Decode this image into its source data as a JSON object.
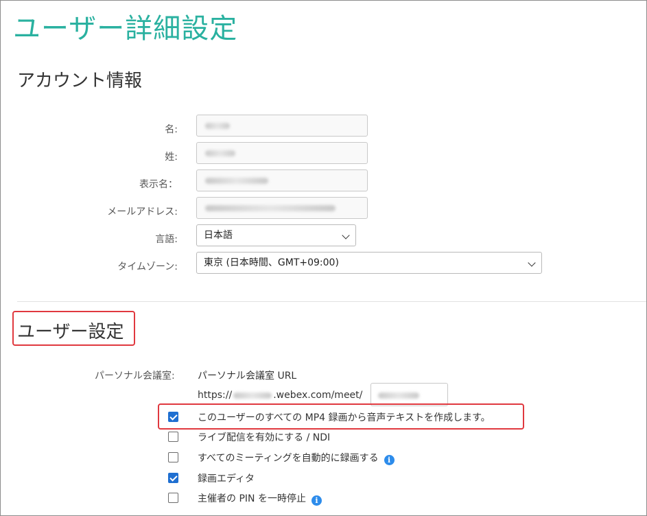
{
  "page_title": "ユーザー詳細設定",
  "account": {
    "section_title": "アカウント情報",
    "fields": [
      {
        "label": "名:",
        "value": ""
      },
      {
        "label": "姓:",
        "value": ""
      },
      {
        "label": "表示名：",
        "value": ""
      },
      {
        "label": "メールアドレス:",
        "value": ""
      }
    ],
    "language": {
      "label": "言語:",
      "selected": "日本語"
    },
    "timezone": {
      "label": "タイムゾーン:",
      "selected": "東京 (日本時間、GMT+09:00)"
    }
  },
  "user_settings": {
    "section_title": "ユーザー設定",
    "personal_room": {
      "label": "パーソナル会議室:",
      "url_label": "パーソナル会議室 URL",
      "url_prefix": "https://",
      "url_domain": ".webex.com/meet/"
    },
    "options": [
      {
        "label": "このユーザーのすべての MP4 録画から音声テキストを作成します。",
        "checked": true
      },
      {
        "label": "ライブ配信を有効にする / NDI",
        "checked": false
      },
      {
        "label": "すべてのミーティングを自動的に録画する",
        "checked": false
      },
      {
        "label": "録画エディタ",
        "checked": true
      },
      {
        "label": "主催者の PIN を一時停止",
        "checked": false
      }
    ],
    "info_icon_glyph": "i"
  },
  "colors": {
    "title": "#2ab1a0",
    "highlight": "#e0383e",
    "checkbox": "#1f6fd1",
    "info": "#2d8ceb"
  }
}
